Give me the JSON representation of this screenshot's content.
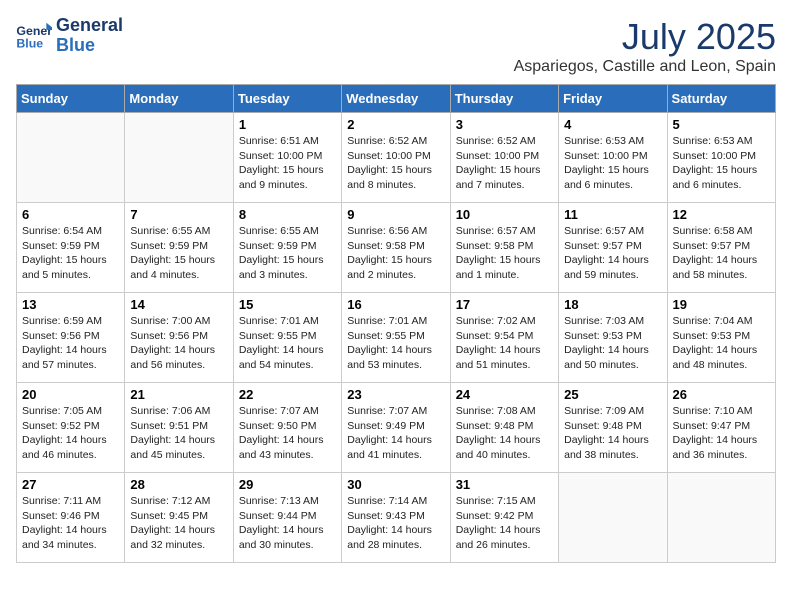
{
  "header": {
    "logo_line1": "General",
    "logo_line2": "Blue",
    "month": "July 2025",
    "location": "Aspariegos, Castille and Leon, Spain"
  },
  "weekdays": [
    "Sunday",
    "Monday",
    "Tuesday",
    "Wednesday",
    "Thursday",
    "Friday",
    "Saturday"
  ],
  "weeks": [
    [
      {
        "day": "",
        "info": ""
      },
      {
        "day": "",
        "info": ""
      },
      {
        "day": "1",
        "info": "Sunrise: 6:51 AM\nSunset: 10:00 PM\nDaylight: 15 hours\nand 9 minutes."
      },
      {
        "day": "2",
        "info": "Sunrise: 6:52 AM\nSunset: 10:00 PM\nDaylight: 15 hours\nand 8 minutes."
      },
      {
        "day": "3",
        "info": "Sunrise: 6:52 AM\nSunset: 10:00 PM\nDaylight: 15 hours\nand 7 minutes."
      },
      {
        "day": "4",
        "info": "Sunrise: 6:53 AM\nSunset: 10:00 PM\nDaylight: 15 hours\nand 6 minutes."
      },
      {
        "day": "5",
        "info": "Sunrise: 6:53 AM\nSunset: 10:00 PM\nDaylight: 15 hours\nand 6 minutes."
      }
    ],
    [
      {
        "day": "6",
        "info": "Sunrise: 6:54 AM\nSunset: 9:59 PM\nDaylight: 15 hours\nand 5 minutes."
      },
      {
        "day": "7",
        "info": "Sunrise: 6:55 AM\nSunset: 9:59 PM\nDaylight: 15 hours\nand 4 minutes."
      },
      {
        "day": "8",
        "info": "Sunrise: 6:55 AM\nSunset: 9:59 PM\nDaylight: 15 hours\nand 3 minutes."
      },
      {
        "day": "9",
        "info": "Sunrise: 6:56 AM\nSunset: 9:58 PM\nDaylight: 15 hours\nand 2 minutes."
      },
      {
        "day": "10",
        "info": "Sunrise: 6:57 AM\nSunset: 9:58 PM\nDaylight: 15 hours\nand 1 minute."
      },
      {
        "day": "11",
        "info": "Sunrise: 6:57 AM\nSunset: 9:57 PM\nDaylight: 14 hours\nand 59 minutes."
      },
      {
        "day": "12",
        "info": "Sunrise: 6:58 AM\nSunset: 9:57 PM\nDaylight: 14 hours\nand 58 minutes."
      }
    ],
    [
      {
        "day": "13",
        "info": "Sunrise: 6:59 AM\nSunset: 9:56 PM\nDaylight: 14 hours\nand 57 minutes."
      },
      {
        "day": "14",
        "info": "Sunrise: 7:00 AM\nSunset: 9:56 PM\nDaylight: 14 hours\nand 56 minutes."
      },
      {
        "day": "15",
        "info": "Sunrise: 7:01 AM\nSunset: 9:55 PM\nDaylight: 14 hours\nand 54 minutes."
      },
      {
        "day": "16",
        "info": "Sunrise: 7:01 AM\nSunset: 9:55 PM\nDaylight: 14 hours\nand 53 minutes."
      },
      {
        "day": "17",
        "info": "Sunrise: 7:02 AM\nSunset: 9:54 PM\nDaylight: 14 hours\nand 51 minutes."
      },
      {
        "day": "18",
        "info": "Sunrise: 7:03 AM\nSunset: 9:53 PM\nDaylight: 14 hours\nand 50 minutes."
      },
      {
        "day": "19",
        "info": "Sunrise: 7:04 AM\nSunset: 9:53 PM\nDaylight: 14 hours\nand 48 minutes."
      }
    ],
    [
      {
        "day": "20",
        "info": "Sunrise: 7:05 AM\nSunset: 9:52 PM\nDaylight: 14 hours\nand 46 minutes."
      },
      {
        "day": "21",
        "info": "Sunrise: 7:06 AM\nSunset: 9:51 PM\nDaylight: 14 hours\nand 45 minutes."
      },
      {
        "day": "22",
        "info": "Sunrise: 7:07 AM\nSunset: 9:50 PM\nDaylight: 14 hours\nand 43 minutes."
      },
      {
        "day": "23",
        "info": "Sunrise: 7:07 AM\nSunset: 9:49 PM\nDaylight: 14 hours\nand 41 minutes."
      },
      {
        "day": "24",
        "info": "Sunrise: 7:08 AM\nSunset: 9:48 PM\nDaylight: 14 hours\nand 40 minutes."
      },
      {
        "day": "25",
        "info": "Sunrise: 7:09 AM\nSunset: 9:48 PM\nDaylight: 14 hours\nand 38 minutes."
      },
      {
        "day": "26",
        "info": "Sunrise: 7:10 AM\nSunset: 9:47 PM\nDaylight: 14 hours\nand 36 minutes."
      }
    ],
    [
      {
        "day": "27",
        "info": "Sunrise: 7:11 AM\nSunset: 9:46 PM\nDaylight: 14 hours\nand 34 minutes."
      },
      {
        "day": "28",
        "info": "Sunrise: 7:12 AM\nSunset: 9:45 PM\nDaylight: 14 hours\nand 32 minutes."
      },
      {
        "day": "29",
        "info": "Sunrise: 7:13 AM\nSunset: 9:44 PM\nDaylight: 14 hours\nand 30 minutes."
      },
      {
        "day": "30",
        "info": "Sunrise: 7:14 AM\nSunset: 9:43 PM\nDaylight: 14 hours\nand 28 minutes."
      },
      {
        "day": "31",
        "info": "Sunrise: 7:15 AM\nSunset: 9:42 PM\nDaylight: 14 hours\nand 26 minutes."
      },
      {
        "day": "",
        "info": ""
      },
      {
        "day": "",
        "info": ""
      }
    ]
  ]
}
